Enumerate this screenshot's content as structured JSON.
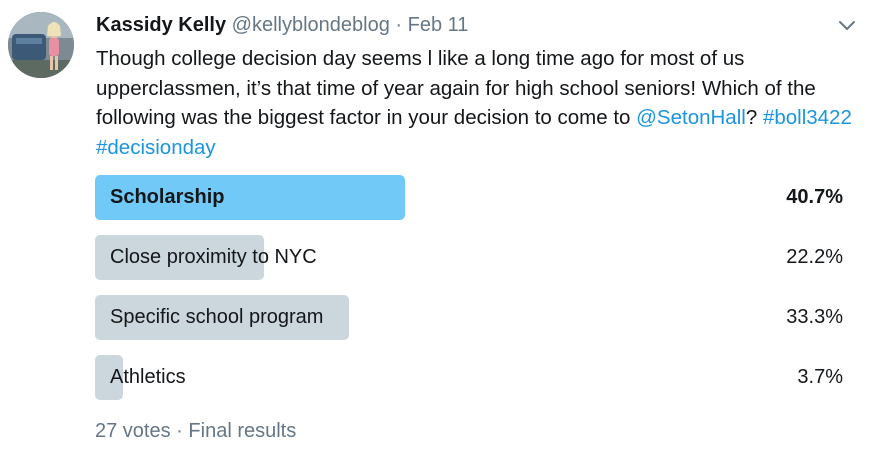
{
  "tweet": {
    "author_name": "Kassidy Kelly",
    "author_handle": "@kellyblondeblog",
    "separator": "·",
    "date": "Feb 11",
    "avatar_icon": "profile-photo",
    "menu_icon": "chevron-down-icon",
    "text_plain": "Though college decision day seems l like a long time ago for most of us upperclassmen, it’s that time of year again for high school seniors! Which of the following was the biggest factor in your decision to come to ",
    "mention": "@SetonHall",
    "text_after_mention": "? ",
    "hashtag_1": "#boll3422",
    "hashtag_space": " ",
    "hashtag_2": "#decisionday"
  },
  "poll": {
    "options": [
      {
        "label": "Scholarship",
        "percent_text": "40.7%",
        "percent": 40.7,
        "winner": true
      },
      {
        "label": "Close proximity to NYC",
        "percent_text": "22.2%",
        "percent": 22.2,
        "winner": false
      },
      {
        "label": "Specific school program",
        "percent_text": "33.3%",
        "percent": 33.3,
        "winner": false
      },
      {
        "label": "Athletics",
        "percent_text": "3.7%",
        "percent": 3.7,
        "winner": false
      }
    ],
    "votes": "27 votes",
    "separator": "·",
    "status": "Final results"
  },
  "colors": {
    "link": "#1b95e0",
    "winner_bar": "#71c9f8",
    "bar": "#ccd6dd",
    "muted_text": "#657786"
  }
}
